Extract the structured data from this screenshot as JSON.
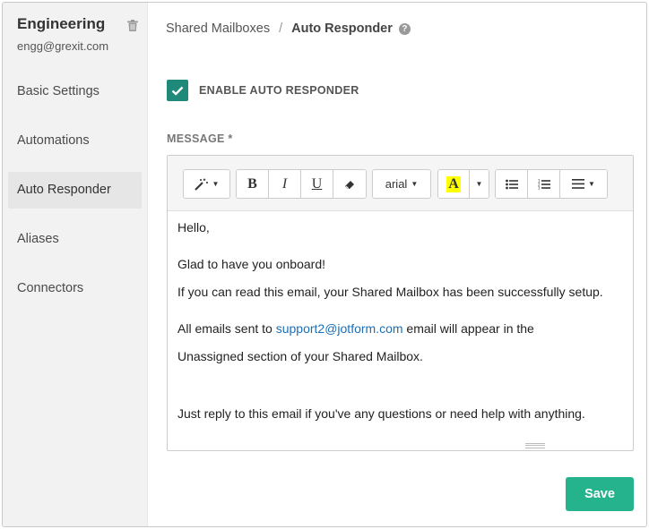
{
  "sidebar": {
    "title": "Engineering",
    "email": "engg@grexit.com",
    "items": [
      {
        "label": "Basic Settings"
      },
      {
        "label": "Automations"
      },
      {
        "label": "Auto Responder"
      },
      {
        "label": "Aliases"
      },
      {
        "label": "Connectors"
      }
    ],
    "active_item": "Auto Responder"
  },
  "breadcrumb": {
    "parent": "Shared Mailboxes",
    "separator": "/",
    "current": "Auto Responder"
  },
  "auto_responder": {
    "enabled": true,
    "enable_label": "ENABLE AUTO RESPONDER"
  },
  "message": {
    "label": "MESSAGE *",
    "toolbar": {
      "bold": "B",
      "italic": "I",
      "underline": "U",
      "font": "arial",
      "highlight": "A",
      "highlight_color": "#ffff00"
    },
    "lines": {
      "l1": "Hello,",
      "l2": "Glad to have you onboard!",
      "l3": "If you can read this email, your Shared Mailbox has been successfully setup.",
      "l4_before": "All emails sent to ",
      "l4_link": "support2@jotform.com",
      "l4_after": " email will appear in the",
      "l5": "Unassigned section of your Shared Mailbox.",
      "l6": "Just reply to this email if you've any questions or need help with anything."
    }
  },
  "actions": {
    "save_label": "Save"
  },
  "colors": {
    "accent": "#25b38e",
    "checkbox": "#1f8a7a",
    "link": "#1a6fb8"
  }
}
